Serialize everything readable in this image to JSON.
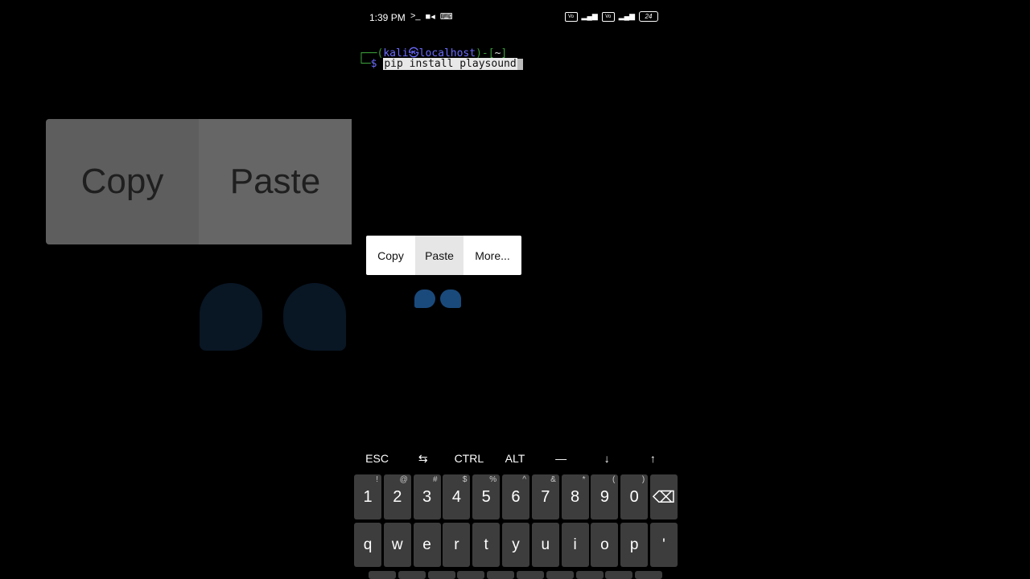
{
  "zoom_overlay": {
    "copy": "Copy",
    "paste": "Paste"
  },
  "status_bar": {
    "time": "1:39 PM",
    "left_icons": [
      "terminal-icon",
      "video-icon",
      "keyboard-icon"
    ],
    "right_icons": [
      "volte-icon",
      "signal-icon",
      "volte-icon",
      "signal-icon"
    ],
    "battery": "24"
  },
  "terminal": {
    "user": "kali",
    "host": "localhost",
    "cwd": "~",
    "command": "pip install playsound"
  },
  "context_menu": {
    "copy": "Copy",
    "paste": "Paste",
    "more": "More..."
  },
  "extra_keys": [
    "ESC",
    "⇆",
    "CTRL",
    "ALT",
    "—",
    "↓",
    "↑"
  ],
  "keyboard": {
    "number_row": [
      {
        "key": "1",
        "alt": "!"
      },
      {
        "key": "2",
        "alt": "@"
      },
      {
        "key": "3",
        "alt": "#"
      },
      {
        "key": "4",
        "alt": "$"
      },
      {
        "key": "5",
        "alt": "%"
      },
      {
        "key": "6",
        "alt": "^"
      },
      {
        "key": "7",
        "alt": "&"
      },
      {
        "key": "8",
        "alt": "*"
      },
      {
        "key": "9",
        "alt": "("
      },
      {
        "key": "0",
        "alt": ")"
      }
    ],
    "letter_row": [
      "q",
      "w",
      "e",
      "r",
      "t",
      "y",
      "u",
      "i",
      "o",
      "p",
      "'"
    ]
  },
  "colors": {
    "prompt_green": "#3a9d3a",
    "prompt_blue": "#6b6bff",
    "handle_blue": "#1a4a7c"
  }
}
